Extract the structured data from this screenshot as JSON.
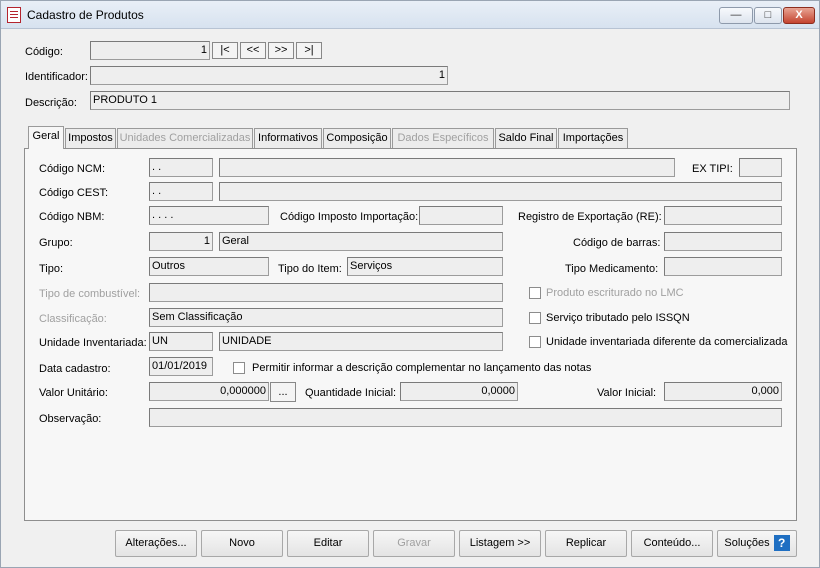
{
  "window": {
    "title": "Cadastro de Produtos",
    "minimize": "—",
    "maximize": "□",
    "close": "X"
  },
  "header": {
    "codigo_label": "Código:",
    "codigo_value": "1",
    "nav": [
      "|<",
      "<<",
      ">>",
      ">|"
    ],
    "identificador_label": "Identificador:",
    "identificador_value": "1",
    "descricao_label": "Descrição:",
    "descricao_value": "PRODUTO 1"
  },
  "tabs": [
    {
      "label": "Geral",
      "active": true,
      "enabled": true
    },
    {
      "label": "Impostos",
      "active": false,
      "enabled": true
    },
    {
      "label": "Unidades Comercializadas",
      "active": false,
      "enabled": false
    },
    {
      "label": "Informativos",
      "active": false,
      "enabled": true
    },
    {
      "label": "Composição",
      "active": false,
      "enabled": true
    },
    {
      "label": "Dados Específicos",
      "active": false,
      "enabled": false
    },
    {
      "label": "Saldo Final",
      "active": false,
      "enabled": true
    },
    {
      "label": "Importações",
      "active": false,
      "enabled": true
    }
  ],
  "geral": {
    "ncm_label": "Código NCM:",
    "ncm_mask": "  .  .",
    "ex_tipi_label": "EX TIPI:",
    "cest_label": "Código CEST:",
    "cest_mask": "  .    .",
    "nbm_label": "Código NBM:",
    "nbm_mask": " .  .  .  .",
    "imposto_importacao_label": "Código Imposto Importação:",
    "registro_exportacao_label": "Registro de Exportação (RE):",
    "grupo_label": "Grupo:",
    "grupo_code": "1",
    "grupo_name": "Geral",
    "codigo_barras_label": "Código de barras:",
    "tipo_label": "Tipo:",
    "tipo_value": "Outros",
    "tipo_item_label": "Tipo do Item:",
    "tipo_item_value": "Serviços",
    "tipo_medicamento_label": "Tipo Medicamento:",
    "tipo_combustivel_label": "Tipo de combustível:",
    "produto_lmc_label": "Produto escriturado no LMC",
    "classificacao_label": "Classificação:",
    "classificacao_value": "Sem Classificação",
    "servico_issqn_label": "Serviço tributado pelo ISSQN",
    "unidade_inv_label": "Unidade Inventariada:",
    "unidade_code": "UN",
    "unidade_name": "UNIDADE",
    "unidade_diferente_label": "Unidade inventariada diferente da comercializada",
    "data_cadastro_label": "Data cadastro:",
    "data_cadastro_value": "01/01/2019",
    "permitir_desc_label": "Permitir informar a descrição complementar no lançamento das notas",
    "valor_unitario_label": "Valor Unitário:",
    "valor_unitario_value": "0,000000",
    "ellipsis": "...",
    "quantidade_inicial_label": "Quantidade Inicial:",
    "quantidade_inicial_value": "0,0000",
    "valor_inicial_label": "Valor Inicial:",
    "valor_inicial_value": "0,000",
    "observacao_label": "Observação:"
  },
  "footer": {
    "alteracoes": "Alterações...",
    "novo": "Novo",
    "editar": "Editar",
    "gravar": "Gravar",
    "listagem": "Listagem >>",
    "replicar": "Replicar",
    "conteudo": "Conteúdo...",
    "solucoes": "Soluções",
    "help": "?"
  },
  "colors": {
    "accent": "#1f6fc2",
    "title_bar": "#dde6f1",
    "disabled_text": "#a0a0a0"
  }
}
